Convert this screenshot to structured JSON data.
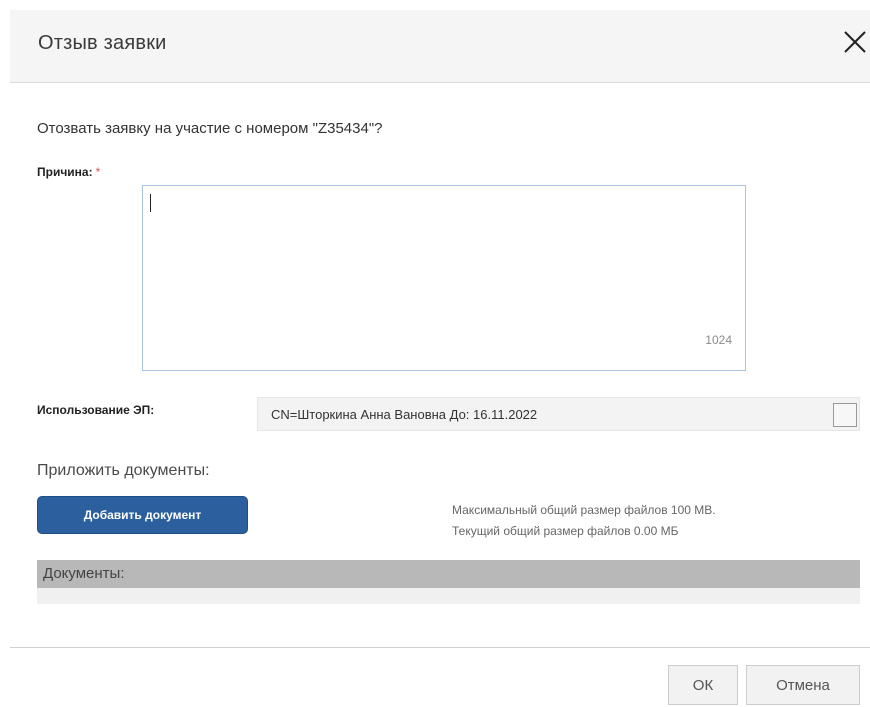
{
  "dialog": {
    "title": "Отзыв заявки",
    "close_icon": "close-icon"
  },
  "question": "Отозвать заявку на участие с номером \"Z35434\"?",
  "reason": {
    "label": "Причина:",
    "required_mark": "*",
    "value": "",
    "char_counter": "1024"
  },
  "signature": {
    "label": "Использование ЭП:",
    "value": "CN=Шторкина Анна Вановна До: 16.11.2022",
    "checked": false
  },
  "attachments": {
    "title": "Приложить документы:",
    "add_button_label": "Добавить документ",
    "max_size_text": "Максимальный общий размер файлов 100 MB.",
    "current_size_text": "Текущий общий размер файлов  0.00  МБ",
    "documents_header": "Документы:"
  },
  "footer": {
    "ok_label": "ОК",
    "cancel_label": "Отмена"
  },
  "colors": {
    "primary_button": "#2b5f9e",
    "required": "#d9534f",
    "input_border": "#a9c3e0"
  }
}
